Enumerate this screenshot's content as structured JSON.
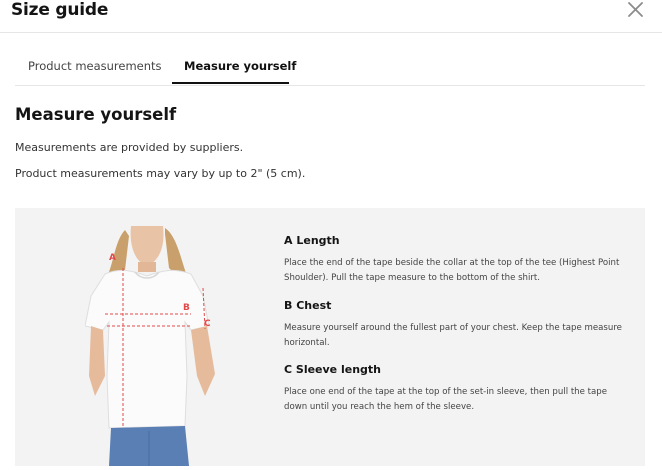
{
  "modal": {
    "title": "Size guide",
    "close_icon": "close-icon"
  },
  "tabs": [
    {
      "label": "Product measurements",
      "active": false
    },
    {
      "label": "Measure yourself",
      "active": true
    }
  ],
  "content": {
    "heading": "Measure yourself",
    "line1": "Measurements are provided by suppliers.",
    "line2": "Product measurements may vary by up to 2\" (5 cm)."
  },
  "figure": {
    "markers": [
      "A",
      "B",
      "C"
    ],
    "marker_color": "#e04a4a"
  },
  "guide": [
    {
      "title": "A Length",
      "text": "Place the end of the tape beside the collar at the top of the tee (Highest Point Shoulder). Pull the tape measure to the bottom of the shirt."
    },
    {
      "title": "B Chest",
      "text": "Measure yourself around the fullest part of your chest. Keep the tape measure horizontal."
    },
    {
      "title": "C Sleeve length",
      "text": "Place one end of the tape at the top of the set-in sleeve, then pull the tape down until you reach the hem of the sleeve."
    }
  ]
}
